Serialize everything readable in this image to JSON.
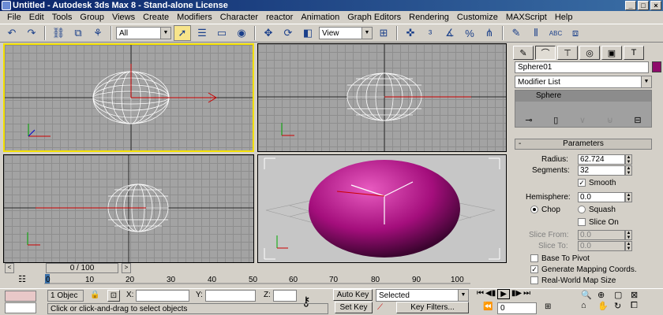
{
  "window": {
    "title": "Untitled - Autodesk 3ds Max 8 - Stand-alone License"
  },
  "menu": [
    "File",
    "Edit",
    "Tools",
    "Group",
    "Views",
    "Create",
    "Modifiers",
    "Character",
    "reactor",
    "Animation",
    "Graph Editors",
    "Rendering",
    "Customize",
    "MAXScript",
    "Help"
  ],
  "toolbar": {
    "filter_value": "All",
    "refcoord_value": "View"
  },
  "command_panel": {
    "object_name": "Sphere01",
    "object_color": "#8e0a6a",
    "modifier_list": "Modifier List",
    "stack_item": "Sphere",
    "parameters_title": "Parameters",
    "radius_label": "Radius:",
    "radius_value": "62.724",
    "segments_label": "Segments:",
    "segments_value": "32",
    "smooth_label": "Smooth",
    "hemisphere_label": "Hemisphere:",
    "hemisphere_value": "0.0",
    "chop_label": "Chop",
    "squash_label": "Squash",
    "slice_on_label": "Slice On",
    "slice_from_label": "Slice From:",
    "slice_from_value": "0.0",
    "slice_to_label": "Slice To:",
    "slice_to_value": "0.0",
    "base_pivot_label": "Base To Pivot",
    "gen_mapping_label": "Generate Mapping Coords.",
    "realworld_label": "Real-World Map Size"
  },
  "timeline": {
    "slider_label": "0 / 100",
    "ticks": [
      "0",
      "10",
      "20",
      "30",
      "40",
      "50",
      "60",
      "70",
      "80",
      "90",
      "100"
    ]
  },
  "status": {
    "selection_count": "1 Objec",
    "x_label": "X:",
    "y_label": "Y:",
    "z_label": "Z:",
    "prompt": "Click or click-and-drag to select objects",
    "autokey_label": "Auto Key",
    "setkey_label": "Set Key",
    "selected_value": "Selected",
    "keyfilters_label": "Key Filters...",
    "frame_value": "0"
  }
}
